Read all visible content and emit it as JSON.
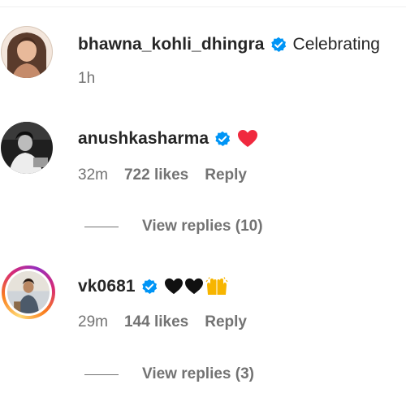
{
  "comments": [
    {
      "username": "bhawna_kohli_dhingra",
      "text": "Celebrating",
      "time": "1h",
      "verified": true
    },
    {
      "username": "anushkasharma",
      "text": "",
      "emoji": [
        "red-heart-icon"
      ],
      "time": "32m",
      "likes": "722 likes",
      "reply": "Reply",
      "view_replies": "View replies (10)",
      "verified": true
    },
    {
      "username": "vk0681",
      "text": "",
      "emoji": [
        "black-heart-icon",
        "black-heart-icon",
        "raising-hands-icon"
      ],
      "time": "29m",
      "likes": "144 likes",
      "reply": "Reply",
      "view_replies": "View replies (3)",
      "verified": true
    }
  ],
  "colors": {
    "verified_blue": "#0095f6",
    "text_primary": "#262626",
    "text_secondary": "#737373",
    "heart_red": "#f0293e"
  }
}
